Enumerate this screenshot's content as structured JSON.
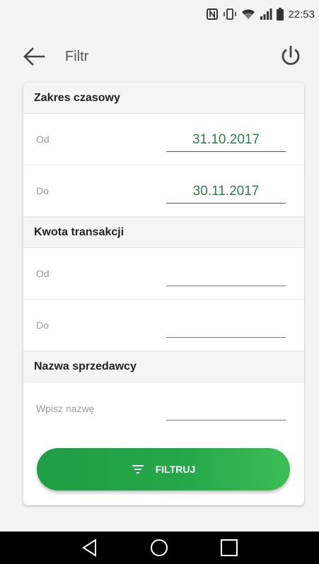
{
  "status_bar": {
    "time": "22:53",
    "icons": [
      "nfc-icon",
      "vibrate-icon",
      "wifi-icon",
      "signal-icon",
      "battery-icon"
    ]
  },
  "toolbar": {
    "title": "Filtr",
    "back_icon": "arrow-left-icon",
    "power_icon": "power-icon"
  },
  "sections": {
    "date_range": {
      "title": "Zakres czasowy",
      "from_label": "Od",
      "from_value": "31.10.2017",
      "to_label": "Do",
      "to_value": "30.11.2017"
    },
    "amount": {
      "title": "Kwota transakcji",
      "from_label": "Od",
      "from_value": "",
      "to_label": "Do",
      "to_value": ""
    },
    "seller": {
      "title": "Nazwa sprzedawcy",
      "name_label": "Wpisz nazwę",
      "name_value": ""
    }
  },
  "filter_button": {
    "label": "FILTRUJ",
    "icon": "filter-icon"
  },
  "colors": {
    "accent_green": "#25a84a",
    "value_green": "#2e7d4f"
  },
  "nav_bar": {
    "icons": [
      "back-triangle-icon",
      "home-circle-icon",
      "recents-square-icon"
    ]
  }
}
